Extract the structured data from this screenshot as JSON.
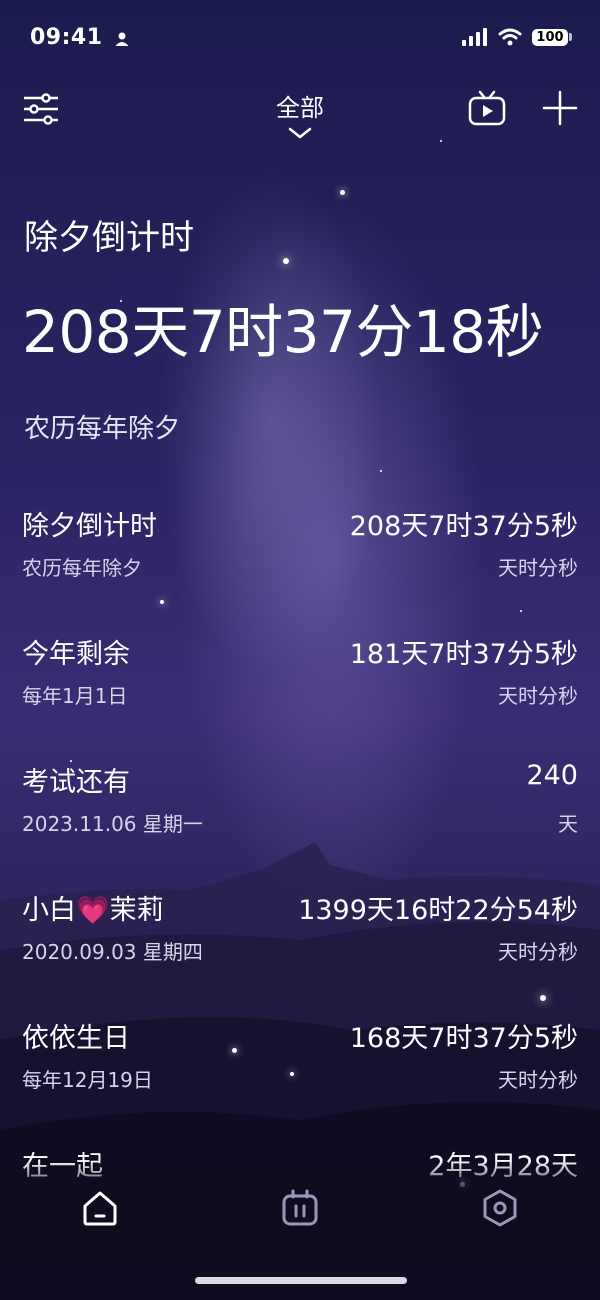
{
  "status_bar": {
    "time": "09:41",
    "battery": "100"
  },
  "header": {
    "tab_title": "全部"
  },
  "hero": {
    "title": "除夕倒计时",
    "countdown": "208天7时37分18秒",
    "subtitle": "农历每年除夕"
  },
  "events": [
    {
      "name": "除夕倒计时",
      "value": "208天7时37分5秒",
      "date": "农历每年除夕",
      "unit": "天时分秒"
    },
    {
      "name": "今年剩余",
      "value": "181天7时37分5秒",
      "date": "每年1月1日",
      "unit": "天时分秒"
    },
    {
      "name": "考试还有",
      "value": "240",
      "date": "2023.11.06  星期一",
      "unit": "天"
    },
    {
      "name": "小白💗茉莉",
      "value": "1399天16时22分54秒",
      "date": "2020.09.03  星期四",
      "unit": "天时分秒"
    },
    {
      "name": "依依生日",
      "value": "168天7时37分5秒",
      "date": "每年12月19日",
      "unit": "天时分秒"
    },
    {
      "name": "在一起",
      "value": "2年3月28天",
      "date": "",
      "unit": ""
    }
  ]
}
